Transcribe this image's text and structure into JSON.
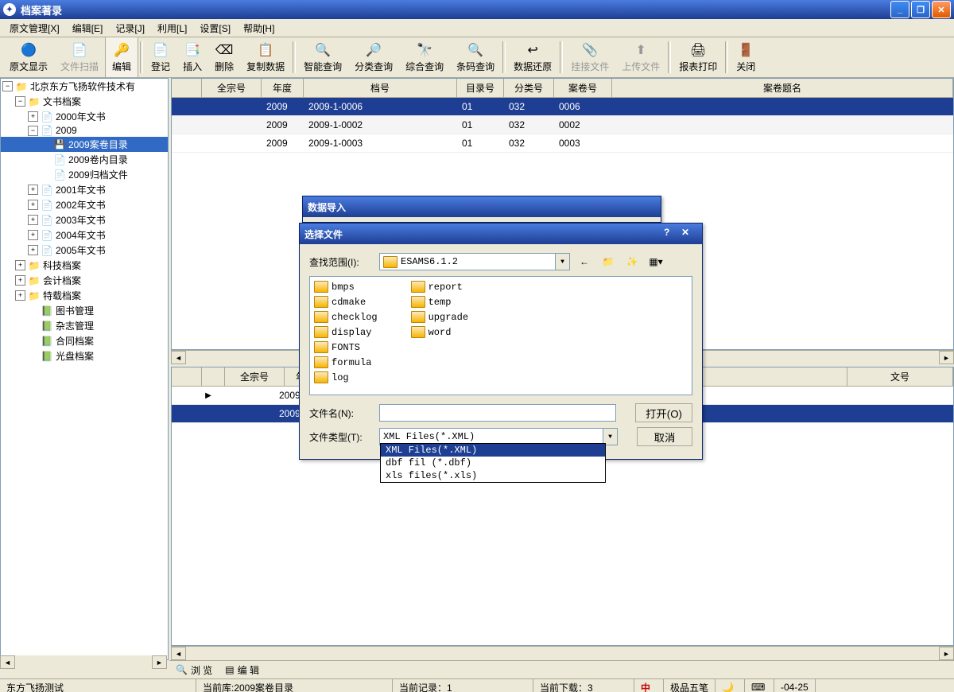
{
  "window": {
    "title": "档案著录"
  },
  "menu": [
    "原文管理[X]",
    "编辑[E]",
    "记录[J]",
    "利用[L]",
    "设置[S]",
    "帮助[H]"
  ],
  "toolbar": [
    {
      "label": "原文显示",
      "enabled": true
    },
    {
      "label": "文件扫描",
      "enabled": false
    },
    {
      "label": "编辑",
      "enabled": true,
      "active": true
    },
    {
      "sep": true
    },
    {
      "label": "登记",
      "enabled": true
    },
    {
      "label": "插入",
      "enabled": true
    },
    {
      "label": "删除",
      "enabled": true
    },
    {
      "label": "复制数据",
      "enabled": true
    },
    {
      "sep": true
    },
    {
      "label": "智能查询",
      "enabled": true
    },
    {
      "label": "分类查询",
      "enabled": true
    },
    {
      "label": "综合查询",
      "enabled": true
    },
    {
      "label": "条码查询",
      "enabled": true
    },
    {
      "sep": true
    },
    {
      "label": "数据还原",
      "enabled": true
    },
    {
      "sep": true
    },
    {
      "label": "挂接文件",
      "enabled": false
    },
    {
      "label": "上传文件",
      "enabled": false
    },
    {
      "sep": true
    },
    {
      "label": "报表打印",
      "enabled": true
    },
    {
      "sep": true
    },
    {
      "label": "关闭",
      "enabled": true
    }
  ],
  "tree": [
    "北京东方飞扬软件技术有",
    "文书档案",
    "2000年文书",
    "2009",
    "2009案卷目录",
    "2009卷内目录",
    "2009归档文件",
    "2001年文书",
    "2002年文书",
    "2003年文书",
    "2004年文书",
    "2005年文书",
    "科技档案",
    "会计档案",
    "特载档案",
    "图书管理",
    "杂志管理",
    "合同档案",
    "光盘档案"
  ],
  "grid": {
    "headers": [
      "全宗号",
      "年度",
      "档号",
      "目录号",
      "分类号",
      "案卷号",
      "案卷题名"
    ],
    "rows": [
      {
        "qzh": "",
        "nd": "2009",
        "dh": "2009-1-0006",
        "mlh": "01",
        "flh": "032",
        "ajh": "0006",
        "sel": true
      },
      {
        "qzh": "",
        "nd": "2009",
        "dh": "2009-1-0002",
        "mlh": "01",
        "flh": "032",
        "ajh": "0002",
        "sel": false
      },
      {
        "qzh": "",
        "nd": "2009",
        "dh": "2009-1-0003",
        "mlh": "01",
        "flh": "032",
        "ajh": "0003",
        "sel": false
      }
    ]
  },
  "grid2": {
    "headers": [
      "全宗号",
      "年度",
      "文号"
    ],
    "rows": [
      {
        "nd": "2009",
        "dh": "2009",
        "sel": false,
        "ind": "▶"
      },
      {
        "nd": "2009",
        "dh": "2009",
        "sel": true
      }
    ]
  },
  "dialog1": {
    "title": "数据导入"
  },
  "dialog2": {
    "title": "选择文件",
    "lookin_label": "查找范围(I):",
    "lookin_value": "ESAMS6.1.2",
    "filename_label": "文件名(N):",
    "filename_value": "",
    "filetype_label": "文件类型(T):",
    "filetype_value": "XML Files(*.XML)",
    "open_btn": "打开(O)",
    "cancel_btn": "取消",
    "files": [
      "bmps",
      "cdmake",
      "checklog",
      "display",
      "FONTS",
      "formula",
      "log",
      "report",
      "temp",
      "upgrade",
      "word"
    ],
    "filetype_options": [
      "XML Files(*.XML)",
      "dbf fil (*.dbf)",
      "xls files(*.xls)"
    ]
  },
  "bottom_tabs": [
    "浏 览",
    "编 辑"
  ],
  "status": {
    "s1": "东方飞扬测试",
    "s2": "当前库:2009案卷目录",
    "s3": "当前记录：1",
    "s4": "当前下载：3",
    "ime": "极品五笔",
    "date": "-04-25"
  }
}
